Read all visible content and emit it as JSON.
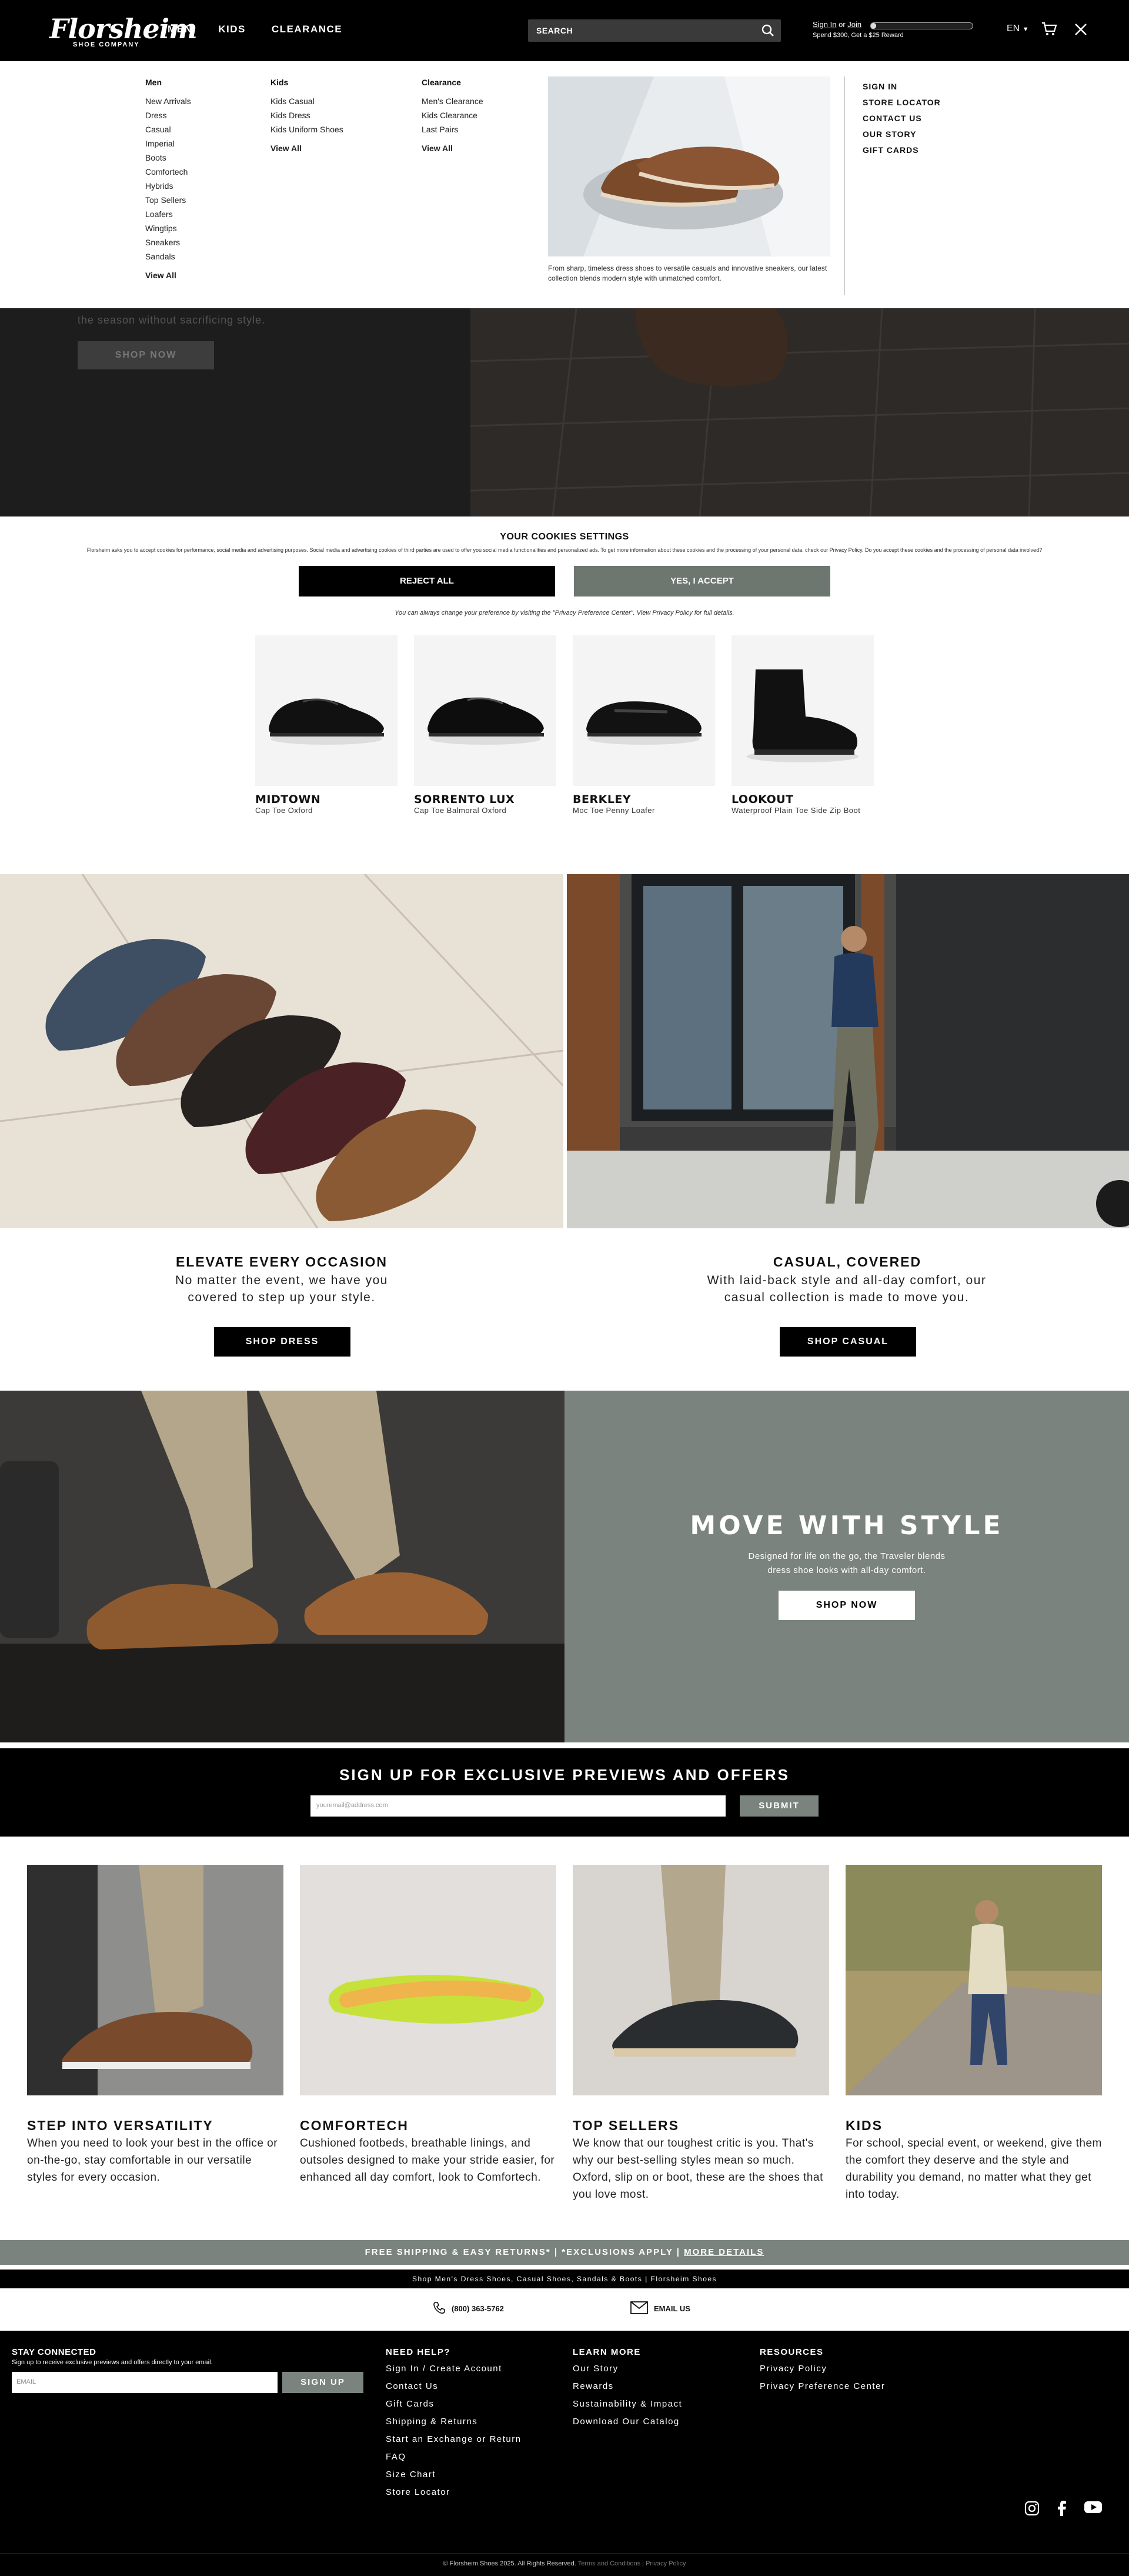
{
  "header": {
    "logo_text": "Florsheim",
    "logo_sub": "SHOE COMPANY",
    "nav": [
      "MEN",
      "KIDS",
      "CLEARANCE"
    ],
    "search_placeholder": "SEARCH",
    "sign_in": "Sign In",
    "or": "or",
    "join": "Join",
    "reward_progress": 0.05,
    "reward_text": "Spend $300, Get a $25 Reward",
    "language": "EN"
  },
  "mega_menu": {
    "men": {
      "title": "Men",
      "items": [
        "New Arrivals",
        "Dress",
        "Casual",
        "Imperial",
        "Boots",
        "Comfortech",
        "Hybrids",
        "Top Sellers",
        "Loafers",
        "Wingtips",
        "Sneakers",
        "Sandals"
      ],
      "view_all": "View All"
    },
    "kids": {
      "title": "Kids",
      "items": [
        "Kids Casual",
        "Kids Dress",
        "Kids Uniform Shoes"
      ],
      "view_all": "View All"
    },
    "clearance": {
      "title": "Clearance",
      "items": [
        "Men's Clearance",
        "Kids Clearance",
        "Last Pairs"
      ],
      "view_all": "View All"
    },
    "promo_caption": "From sharp, timeless dress shoes to versatile casuals and innovative sneakers, our latest collection blends modern style with unmatched comfort.",
    "right_links": [
      "SIGN IN",
      "STORE LOCATOR",
      "CONTACT US",
      "OUR STORY",
      "GIFT CARDS"
    ]
  },
  "hero": {
    "subtitle": "the season without sacrificing style.",
    "button": "SHOP NOW"
  },
  "cookies": {
    "title": "YOUR COOKIES SETTINGS",
    "text": "Florsheim asks you to accept cookies for performance, social media and advertising purposes. Social media and advertising cookies of third parties are used to offer you social media functionalities and personalized ads. To get more information about these cookies and the processing of your personal data, check our Privacy Policy. Do you accept these cookies and the processing of personal data involved?",
    "reject": "REJECT ALL",
    "accept": "YES, I ACCEPT",
    "footer": "You can always change your preference by visiting the \"Privacy Preference Center\". View Privacy Policy for full details."
  },
  "products": [
    {
      "name": "MIDTOWN",
      "desc": "Cap Toe Oxford"
    },
    {
      "name": "SORRENTO LUX",
      "desc": "Cap Toe Balmoral Oxford"
    },
    {
      "name": "BERKLEY",
      "desc": "Moc Toe Penny Loafer"
    },
    {
      "name": "LOOKOUT",
      "desc": "Waterproof Plain Toe Side Zip Boot"
    }
  ],
  "tiles": [
    {
      "title": "ELEVATE EVERY OCCASION",
      "text": "No matter the event, we have you covered to step up your style.",
      "button": "SHOP DRESS"
    },
    {
      "title": "CASUAL, COVERED",
      "text": "With laid-back style and all-day comfort, our casual collection is made to move you.",
      "button": "SHOP CASUAL"
    }
  ],
  "move_with_style": {
    "title": "MOVE WITH STYLE",
    "text": "Designed for life on the go, the Traveler blends dress shoe looks with all-day comfort.",
    "button": "SHOP NOW"
  },
  "signup": {
    "title": "SIGN UP FOR EXCLUSIVE PREVIEWS AND OFFERS",
    "placeholder": "youremail@address.com",
    "button": "SUBMIT"
  },
  "features": [
    {
      "title": "STEP INTO VERSATILITY",
      "text": "When you need to look your best in the office or on-the-go, stay comfortable in our versatile styles for every occasion."
    },
    {
      "title": "COMFORTECH",
      "text": "Cushioned footbeds, breathable linings, and outsoles designed to make your stride easier, for enhanced all day comfort, look to Comfortech."
    },
    {
      "title": "TOP SELLERS",
      "text": "We know that our toughest critic is you. That's why our best-selling styles mean so much. Oxford, slip on or boot, these are the shoes that you love most."
    },
    {
      "title": "KIDS",
      "text": "For school, special event, or weekend, give them the comfort they deserve and the style and durability you demand, no matter what they get into today."
    }
  ],
  "shipping": {
    "text": "FREE SHIPPING & EASY RETURNS* | *EXCLUSIONS APPLY | ",
    "link": "MORE DETAILS"
  },
  "shop_line": "Shop Men's Dress Shoes, Casual Shoes, Sandals & Boots | Florsheim Shoes",
  "contact": {
    "phone": "(800) 363-5762",
    "email": "EMAIL US"
  },
  "footer": {
    "stay_title": "STAY CONNECTED",
    "stay_text": "Sign up to receive exclusive previews and offers directly to your email.",
    "email_placeholder": "EMAIL",
    "signup_button": "SIGN UP",
    "need_help": {
      "title": "NEED HELP?",
      "links": [
        "Sign In / Create Account",
        "Contact Us",
        "Gift Cards",
        "Shipping & Returns",
        "Start an Exchange or Return",
        "FAQ",
        "Size Chart",
        "Store Locator"
      ]
    },
    "learn_more": {
      "title": "LEARN MORE",
      "links": [
        "Our Story",
        "Rewards",
        "Sustainability & Impact",
        "Download Our Catalog"
      ]
    },
    "resources": {
      "title": "RESOURCES",
      "links": [
        "Privacy Policy",
        "Privacy Preference Center"
      ]
    },
    "copyright": "© Florsheim Shoes 2025. All Rights Reserved.",
    "terms": "Terms and Conditions",
    "privacy": "Privacy Policy"
  },
  "colors": {
    "black": "#000000",
    "accent_gray": "#7b837f"
  }
}
